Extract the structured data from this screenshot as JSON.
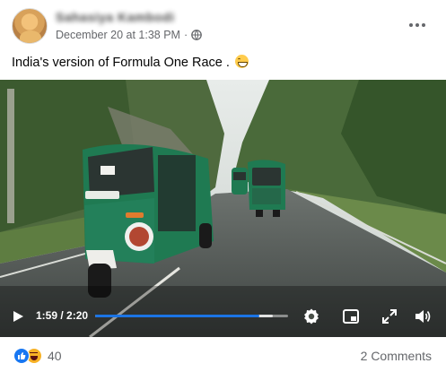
{
  "post": {
    "author_name": "Sahasiya Kambodi",
    "date": "December 20 at 1:38 PM",
    "separator": "·",
    "text": "India's version of Formula One Race ."
  },
  "video": {
    "current_time": "1:59",
    "duration": "2:20",
    "time_separator": " / ",
    "progress_fraction": 0.85,
    "buffered_fraction": 0.92
  },
  "footer": {
    "reaction_count": "40",
    "comments_label": "2 Comments"
  },
  "icons": {
    "play": "play-icon",
    "settings": "gear-icon",
    "pip": "picture-in-picture-icon",
    "fullscreen": "fullscreen-icon",
    "volume": "volume-icon",
    "privacy": "globe-icon",
    "more": "more-icon",
    "like": "like-icon",
    "haha": "haha-icon"
  },
  "colors": {
    "accent": "#1b74e4",
    "secondary_text": "#65676b",
    "rickshaw_green": "#1f7a52"
  }
}
